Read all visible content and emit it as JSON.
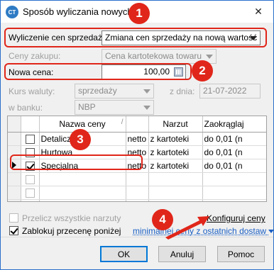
{
  "window": {
    "title": "Sposób wyliczania nowych cen",
    "app_icon_text": "CT",
    "close_glyph": "✕"
  },
  "form": {
    "mode_label": "Wyliczenie cen sprzedaży:",
    "mode_value": "Zmiana cen sprzedaży na nową wartość",
    "purchase_label": "Ceny zakupu:",
    "purchase_value": "Cena kartotekowa towaru",
    "new_price_label": "Nowa cena:",
    "new_price_value": "100,00",
    "fx_label": "Kurs waluty:",
    "fx_value": "sprzedaży",
    "date_label": "z dnia:",
    "date_value": "21-07-2022",
    "bank_label": "w banku:",
    "bank_value": "NBP"
  },
  "grid": {
    "headers": [
      "",
      "",
      "Nazwa ceny",
      "",
      "Narzut",
      "Zaokrąglaj"
    ],
    "rows": [
      {
        "current": false,
        "checked": false,
        "name": "Detaliczna",
        "type": "netto",
        "markup": "z kartoteki",
        "rounding": "do 0,01 (n"
      },
      {
        "current": false,
        "checked": false,
        "name": "Hurtowa",
        "type": "netto",
        "markup": "z kartoteki",
        "rounding": "do 0,01 (n"
      },
      {
        "current": true,
        "checked": true,
        "name": "Specjalna",
        "type": "netto",
        "markup": "z kartoteki",
        "rounding": "do 0,01 (n"
      },
      {
        "current": false,
        "checked": false,
        "name": "",
        "type": "",
        "markup": "",
        "rounding": ""
      },
      {
        "current": false,
        "checked": false,
        "name": "",
        "type": "",
        "markup": "",
        "rounding": ""
      },
      {
        "current": false,
        "checked": false,
        "name": "",
        "type": "",
        "markup": "",
        "rounding": ""
      }
    ]
  },
  "options": {
    "recalc_label": "Przelicz wszystkie narzuty",
    "configure_label": "Konfiguruj ceny",
    "lock_label": "Zablokuj przecenę poniżej",
    "lock_link": "minimalnej ceny z ostatnich dostaw"
  },
  "buttons": {
    "ok": "OK",
    "cancel": "Anuluj",
    "help": "Pomoc"
  },
  "annotations": {
    "badge1": "1",
    "badge2": "2",
    "badge3": "3",
    "badge4": "4",
    "accent_color": "#e0261a"
  }
}
